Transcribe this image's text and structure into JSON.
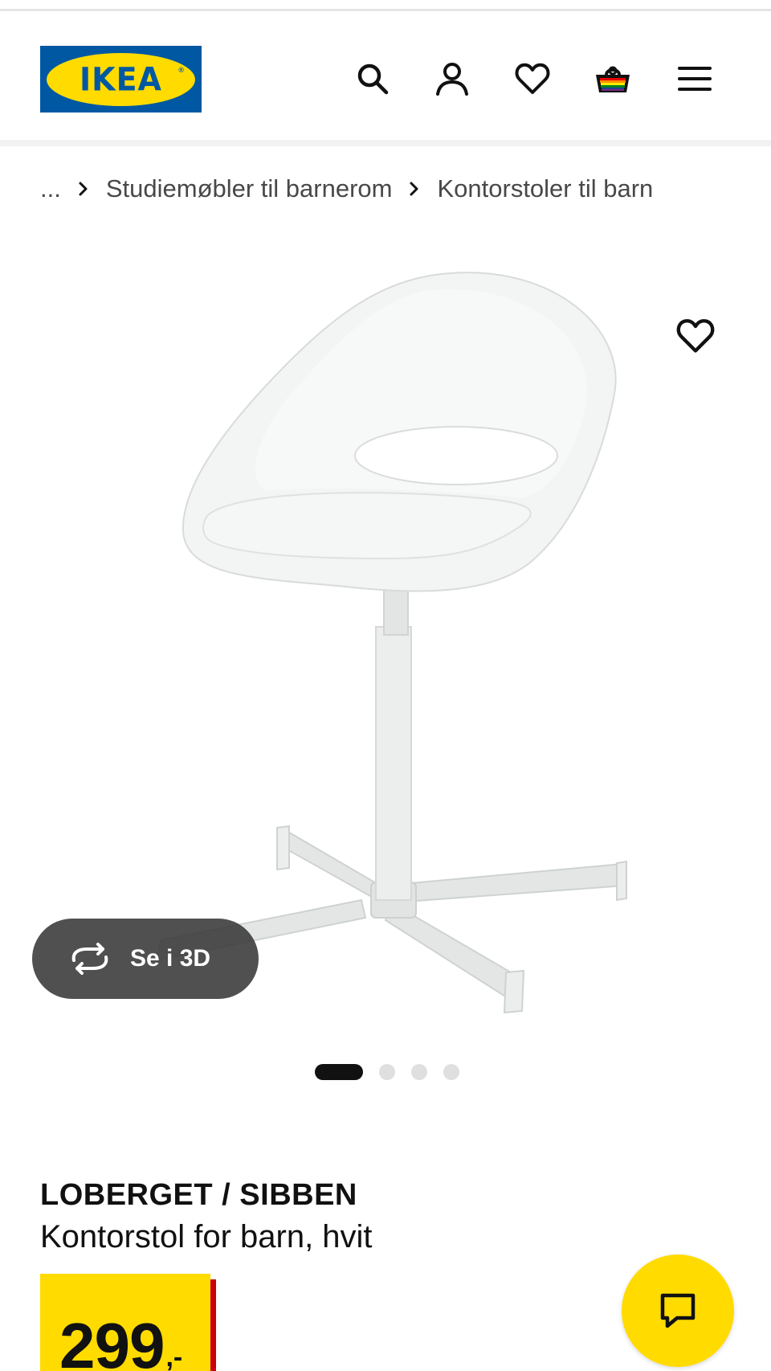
{
  "header": {
    "logo_text": "IKEA",
    "logo_reg": "®",
    "icons": [
      "search-icon",
      "user-icon",
      "heart-icon",
      "basket-icon",
      "menu-icon"
    ]
  },
  "breadcrumb": {
    "ellipsis": "...",
    "items": [
      "Studiemøbler til barnerom",
      "Kontorstoler til barn"
    ]
  },
  "gallery": {
    "view_3d_label": "Se i 3D",
    "total_images": 4,
    "current_image": 1
  },
  "product": {
    "name": "LOBERGET / SIBBEN",
    "description": "Kontorstol for barn, hvit",
    "price_integer": "299",
    "price_suffix": ",-"
  },
  "colors": {
    "brand_blue": "#0058a3",
    "brand_yellow": "#ffdb00",
    "price_red": "#cc0008"
  }
}
